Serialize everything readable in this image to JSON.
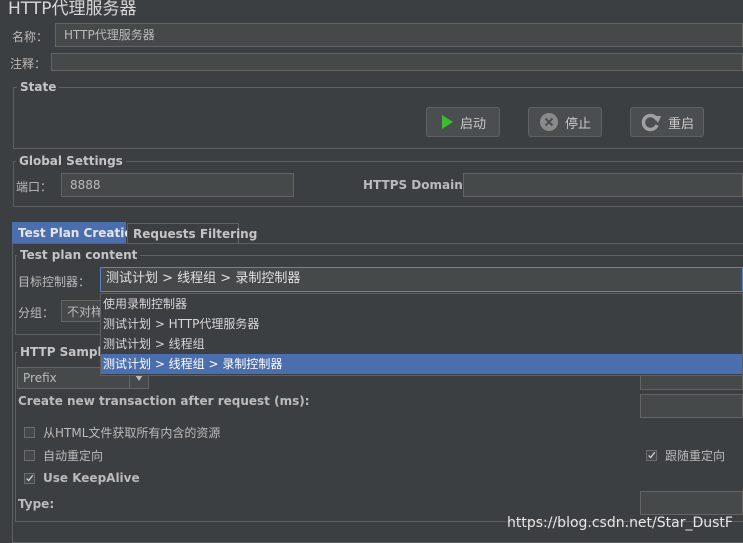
{
  "window": {
    "title": "HTTP代理服务器"
  },
  "name_row": {
    "label": "名称：",
    "value": "HTTP代理服务器"
  },
  "comment_row": {
    "label": "注释：",
    "value": ""
  },
  "state": {
    "title": "State",
    "start_label": "启动",
    "stop_label": "停止",
    "restart_label": "重启"
  },
  "global": {
    "title": "Global Settings",
    "port_label": "端口：",
    "port_value": "8888",
    "https_label": "HTTPS Domains:",
    "https_value": ""
  },
  "tabs": [
    {
      "label": "Test Plan Creation",
      "active": true
    },
    {
      "label": "Requests Filtering",
      "active": false
    }
  ],
  "test_plan": {
    "title": "Test plan content",
    "target_label": "目标控制器：",
    "target_value": "测试计划 > 线程组 > 录制控制器",
    "group_label": "分组：",
    "group_value": "不对样",
    "options": [
      "使用录制控制器",
      "测试计划 > HTTP代理服务器",
      "测试计划 > 线程组",
      "测试计划 > 线程组 > 录制控制器"
    ],
    "selected_index": 3
  },
  "sampler": {
    "title": "HTTP Sampler",
    "prefix_value": "Prefix",
    "transaction_label": "Create new transaction after request (ms):",
    "checkboxes": [
      {
        "label": "从HTML文件获取所有内含的资源",
        "checked": false
      },
      {
        "label": "自动重定向",
        "checked": false
      },
      {
        "label": "Use KeepAlive",
        "checked": true
      }
    ],
    "follow_redirect": {
      "label": "跟随重定向",
      "checked": true
    },
    "type_label": "Type:"
  },
  "watermark": "https://blog.csdn.net/Star_DustF",
  "colors": {
    "background": "#3c3f41",
    "accent": "#4b6eaf",
    "start_green": "#3dbb2f"
  },
  "icons": {
    "start": "play-icon",
    "stop": "stop-icon",
    "restart": "restart-icon",
    "check": "check-icon"
  }
}
